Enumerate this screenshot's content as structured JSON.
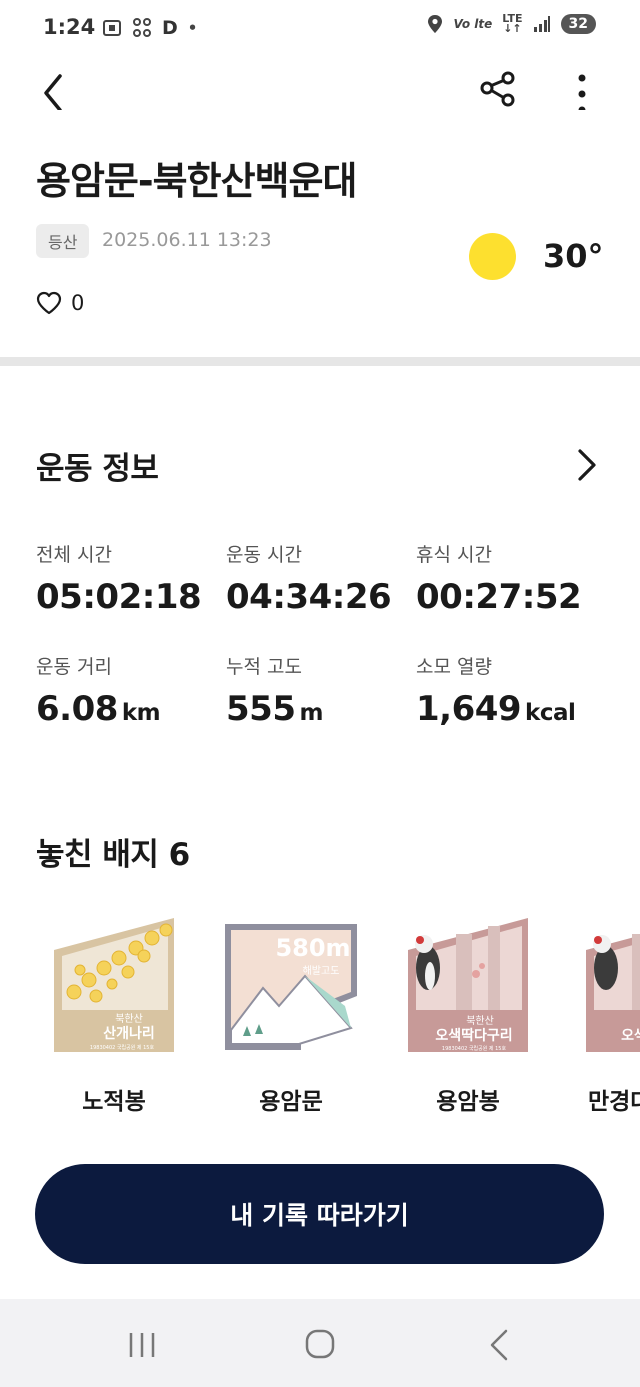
{
  "status_bar": {
    "time": "1:24",
    "left_icons": [
      "screenshot-icon",
      "dots-icon",
      "d-app-icon",
      "notification-dot-icon"
    ],
    "right_icons": [
      "location-icon",
      "volte-icon",
      "lte-icon",
      "signal-icon"
    ],
    "battery": "32"
  },
  "app_bar": {
    "icons": [
      "back-icon",
      "share-icon",
      "more-icon"
    ]
  },
  "record": {
    "title": "용암문-북한산백운대",
    "tag": "등산",
    "datetime": "2025.06.11 13:23",
    "weather_icon": "sun-icon",
    "temperature": "30°",
    "likes": "0"
  },
  "exercise_info": {
    "title": "운동 정보",
    "stats": [
      {
        "label": "전체 시간",
        "value": "05:02:18",
        "unit": ""
      },
      {
        "label": "운동 시간",
        "value": "04:34:26",
        "unit": ""
      },
      {
        "label": "휴식 시간",
        "value": "00:27:52",
        "unit": ""
      },
      {
        "label": "운동 거리",
        "value": "6.08",
        "unit": "km"
      },
      {
        "label": "누적 고도",
        "value": "555",
        "unit": "m"
      },
      {
        "label": "소모 열량",
        "value": "1,649",
        "unit": "kcal"
      }
    ]
  },
  "missed_badges": {
    "title": "놓친 배지 6",
    "items": [
      {
        "name": "노적봉",
        "badge_sub": "북한산",
        "badge_main": "산개나리",
        "badge_footer": "19830402 국립공원 제 15호"
      },
      {
        "name": "용암문",
        "badge_sub": "580m",
        "badge_main": "해발고도",
        "badge_footer": ""
      },
      {
        "name": "용암봉",
        "badge_sub": "북한산",
        "badge_main": "오색딱다구리",
        "badge_footer": "19830402 국립공원 제 15호"
      },
      {
        "name": "만경대",
        "badge_sub": "",
        "badge_main": "오색",
        "badge_footer": ""
      }
    ]
  },
  "actions": {
    "follow_label": "내 기록 따라가기"
  },
  "colors": {
    "button": "#0c1a3e",
    "sun": "#fde02f",
    "badge_tan": "#d8c4a2",
    "badge_red": "#c79a98"
  }
}
